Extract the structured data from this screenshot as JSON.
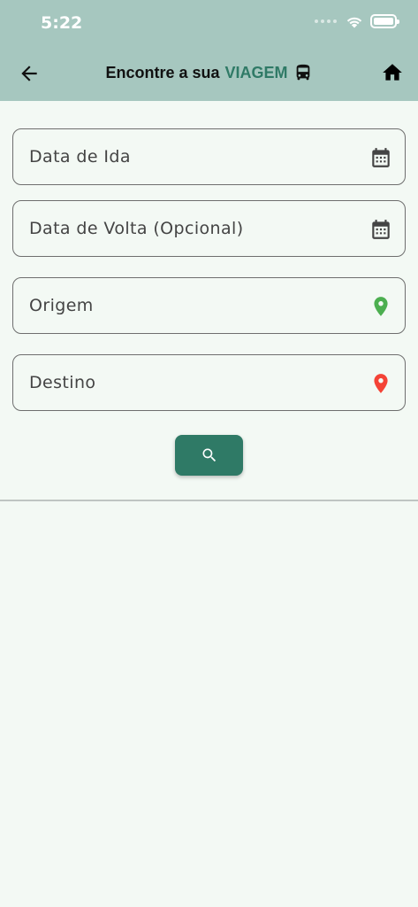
{
  "status_bar": {
    "time": "5:22"
  },
  "nav": {
    "title_prefix": "Encontre a sua",
    "title_accent": "VIAGEM",
    "back_icon": "arrow-left-icon",
    "title_icon": "bus-icon",
    "home_icon": "home-icon"
  },
  "form": {
    "departure_date": {
      "placeholder": "Data de Ida",
      "icon": "calendar-icon"
    },
    "return_date": {
      "placeholder": "Data de Volta (Opcional)",
      "icon": "calendar-icon"
    },
    "origin": {
      "placeholder": "Origem",
      "icon": "location-pin-icon",
      "icon_color": "#4caf50"
    },
    "destination": {
      "placeholder": "Destino",
      "icon": "location-pin-icon",
      "icon_color": "#f44336"
    },
    "search_button": {
      "icon": "search-icon",
      "color": "#2f7a66"
    }
  },
  "colors": {
    "header_bg": "#a6c7bf",
    "accent": "#2f7a66",
    "page_bg": "#f3f9f4"
  }
}
